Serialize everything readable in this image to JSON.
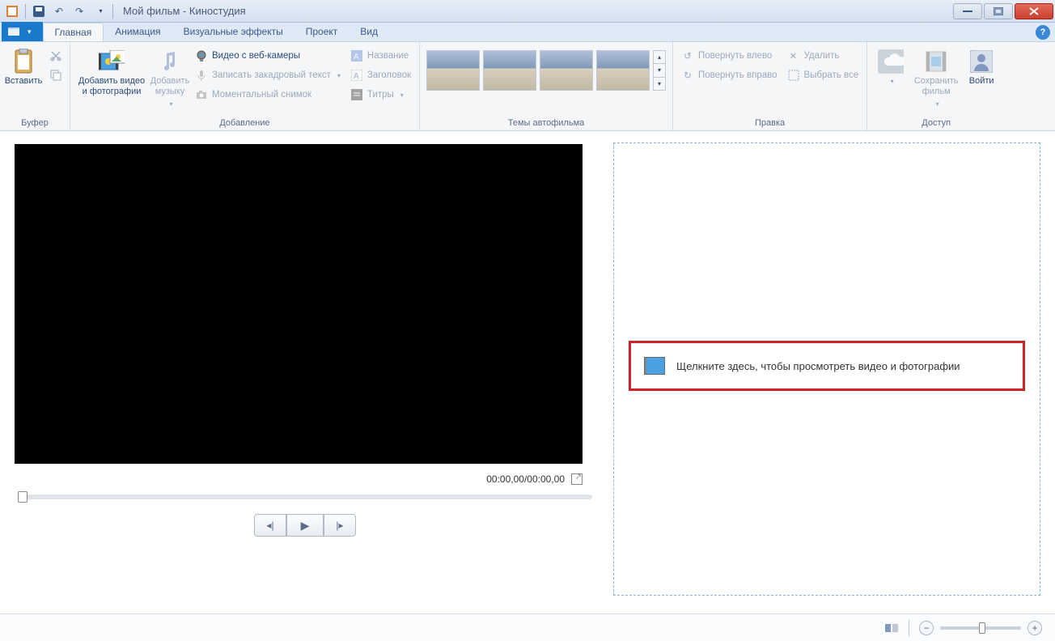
{
  "titlebar": {
    "title": "Мой фильм - Киностудия"
  },
  "tabs": {
    "file": "",
    "items": [
      "Главная",
      "Анимация",
      "Визуальные эффекты",
      "Проект",
      "Вид"
    ],
    "active_index": 0
  },
  "ribbon": {
    "buffer": {
      "label": "Буфер",
      "paste": "Вставить"
    },
    "adding": {
      "label": "Добавление",
      "add_media": "Добавить видео и фотографии",
      "add_music": "Добавить музыку",
      "webcam": "Видео с веб-камеры",
      "narration": "Записать закадровый текст",
      "snapshot": "Моментальный снимок",
      "caption": "Название",
      "title": "Заголовок",
      "credits": "Титры"
    },
    "themes": {
      "label": "Темы автофильма"
    },
    "editing": {
      "label": "Правка",
      "rotate_left": "Повернуть влево",
      "rotate_right": "Повернуть вправо",
      "delete": "Удалить",
      "select_all": "Выбрать все"
    },
    "access": {
      "label": "Доступ",
      "save_movie": "Сохранить фильм",
      "signin": "Войти"
    }
  },
  "preview": {
    "time": "00:00,00/00:00,00"
  },
  "timeline": {
    "drop_hint": "Щелкните здесь, чтобы просмотреть видео и фотографии"
  }
}
